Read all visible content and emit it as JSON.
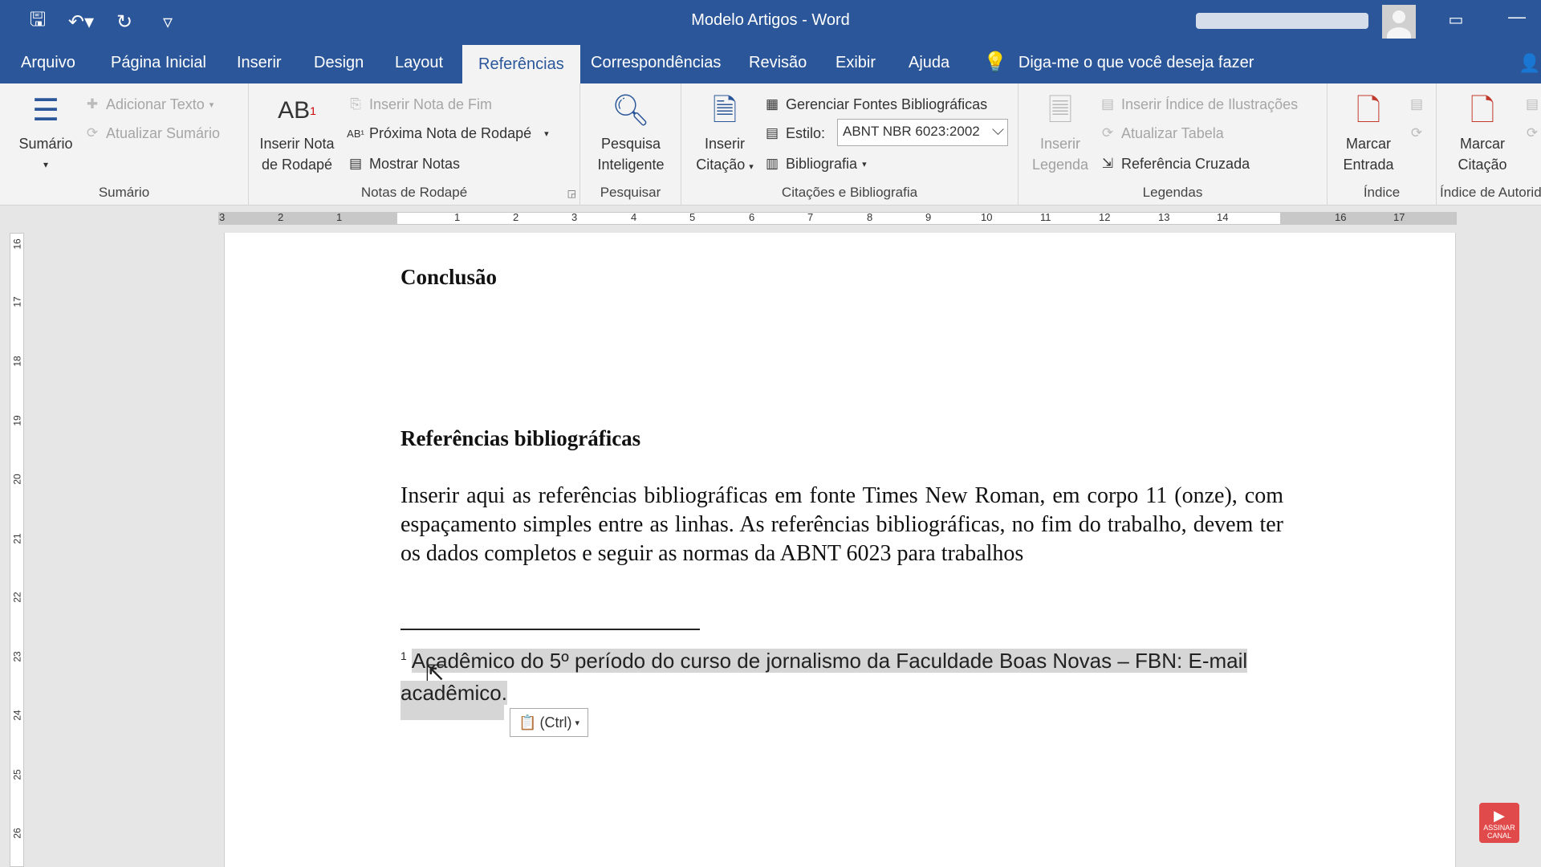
{
  "window": {
    "title": "Modelo Artigos  -  Word",
    "ribbon_display_icon": "ribbon-display-options-icon",
    "minimize_glyph": "—"
  },
  "qat": [
    {
      "name": "save-icon",
      "glyph": "🖫"
    },
    {
      "name": "undo-icon",
      "glyph": "↶▾"
    },
    {
      "name": "redo-icon",
      "glyph": "↻"
    },
    {
      "name": "customize-qat-icon",
      "glyph": "▿"
    }
  ],
  "tabs": [
    {
      "label": "Arquivo"
    },
    {
      "label": "Página Inicial"
    },
    {
      "label": "Inserir"
    },
    {
      "label": "Design"
    },
    {
      "label": "Layout"
    },
    {
      "label": "Referências"
    },
    {
      "label": "Correspondências"
    },
    {
      "label": "Revisão"
    },
    {
      "label": "Exibir"
    },
    {
      "label": "Ajuda"
    }
  ],
  "active_tab": "Referências",
  "tell_me": "Diga-me o que você deseja fazer",
  "ribbon": {
    "sumario": {
      "big": "Sumário",
      "add_text": "Adicionar Texto",
      "update": "Atualizar Sumário",
      "label": "Sumário"
    },
    "notas": {
      "insert_footnote_line1": "Inserir Nota",
      "insert_footnote_line2": "de Rodapé",
      "insert_endnote": "Inserir Nota de Fim",
      "next_footnote": "Próxima Nota de Rodapé",
      "show_notes": "Mostrar Notas",
      "label": "Notas de Rodapé"
    },
    "pesquisar": {
      "line1": "Pesquisa",
      "line2": "Inteligente",
      "label": "Pesquisar"
    },
    "citacoes": {
      "insert_citation_line1": "Inserir",
      "insert_citation_line2": "Citação",
      "manage_sources": "Gerenciar Fontes Bibliográficas",
      "style_label": "Estilo:",
      "style_value": "ABNT NBR 6023:2002",
      "bibliography": "Bibliografia",
      "label": "Citações e Bibliografia"
    },
    "legendas": {
      "insert_caption_line1": "Inserir",
      "insert_caption_line2": "Legenda",
      "insert_table_figures": "Inserir Índice de Ilustrações",
      "update_table": "Atualizar Tabela",
      "cross_reference": "Referência Cruzada",
      "label": "Legendas"
    },
    "indice": {
      "line1": "Marcar",
      "line2": "Entrada",
      "label": "Índice"
    },
    "autoridades": {
      "line1": "Marcar",
      "line2": "Citação",
      "label": "Índice de Autoridades"
    }
  },
  "ruler": {
    "h_numbers": [
      "3",
      "2",
      "1",
      "1",
      "2",
      "3",
      "4",
      "5",
      "6",
      "7",
      "8",
      "9",
      "10",
      "11",
      "12",
      "13",
      "14",
      "16",
      "17"
    ],
    "v_numbers": [
      "16",
      "17",
      "18",
      "19",
      "20",
      "21",
      "22",
      "23",
      "24",
      "25",
      "26"
    ],
    "tab_selector": "L"
  },
  "document": {
    "heading1": "Conclusão",
    "heading2": "Referências bibliográficas",
    "body": "Inserir aqui as referências bibliográficas em fonte Times New Roman, em corpo 11 (onze), com espaçamento simples entre as linhas. As referências bibliográficas, no fim do trabalho, devem ter os dados completos e seguir as normas da ABNT 6023 para trabalhos",
    "footnote_mark": "1",
    "footnote_text": "Acadêmico do 5º período do curso de jornalismo da Faculdade Boas Novas – FBN: E-mail acadêmico.",
    "paste_options": "(Ctrl)"
  },
  "badge": {
    "line1": "ASSINAR",
    "line2": "CANAL"
  }
}
